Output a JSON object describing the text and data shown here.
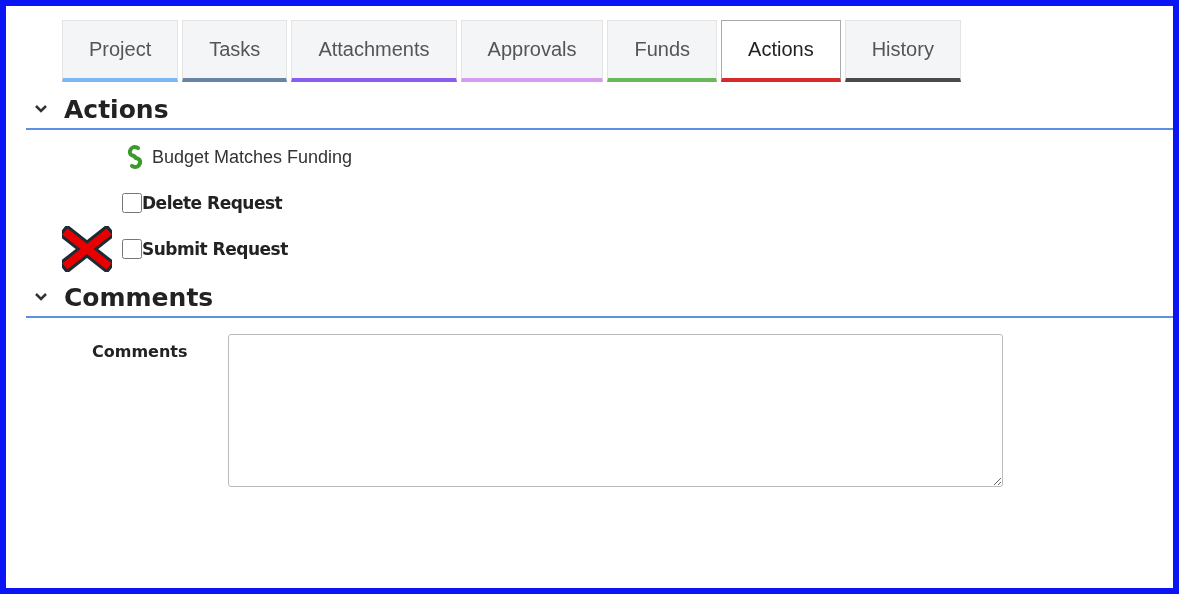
{
  "tabs": [
    {
      "label": "Project",
      "color": "#7db6f5",
      "selected": false
    },
    {
      "label": "Tasks",
      "color": "#6783a6",
      "selected": false
    },
    {
      "label": "Attachments",
      "color": "#8a5cf0",
      "selected": false
    },
    {
      "label": "Approvals",
      "color": "#d69cee",
      "selected": false
    },
    {
      "label": "Funds",
      "color": "#6bb85a",
      "selected": false
    },
    {
      "label": "Actions",
      "color": "#d42a2a",
      "selected": true
    },
    {
      "label": "History",
      "color": "#4a4a4a",
      "selected": false
    }
  ],
  "actions": {
    "title": "Actions",
    "expanded": true,
    "items": [
      {
        "kind": "status",
        "label": "Budget Matches Funding"
      },
      {
        "kind": "checkbox",
        "label": "Delete Request",
        "checked": false,
        "marked": false
      },
      {
        "kind": "checkbox",
        "label": "Submit Request",
        "checked": false,
        "marked": true
      }
    ]
  },
  "comments": {
    "title": "Comments",
    "expanded": true,
    "field_label": "Comments"
  }
}
